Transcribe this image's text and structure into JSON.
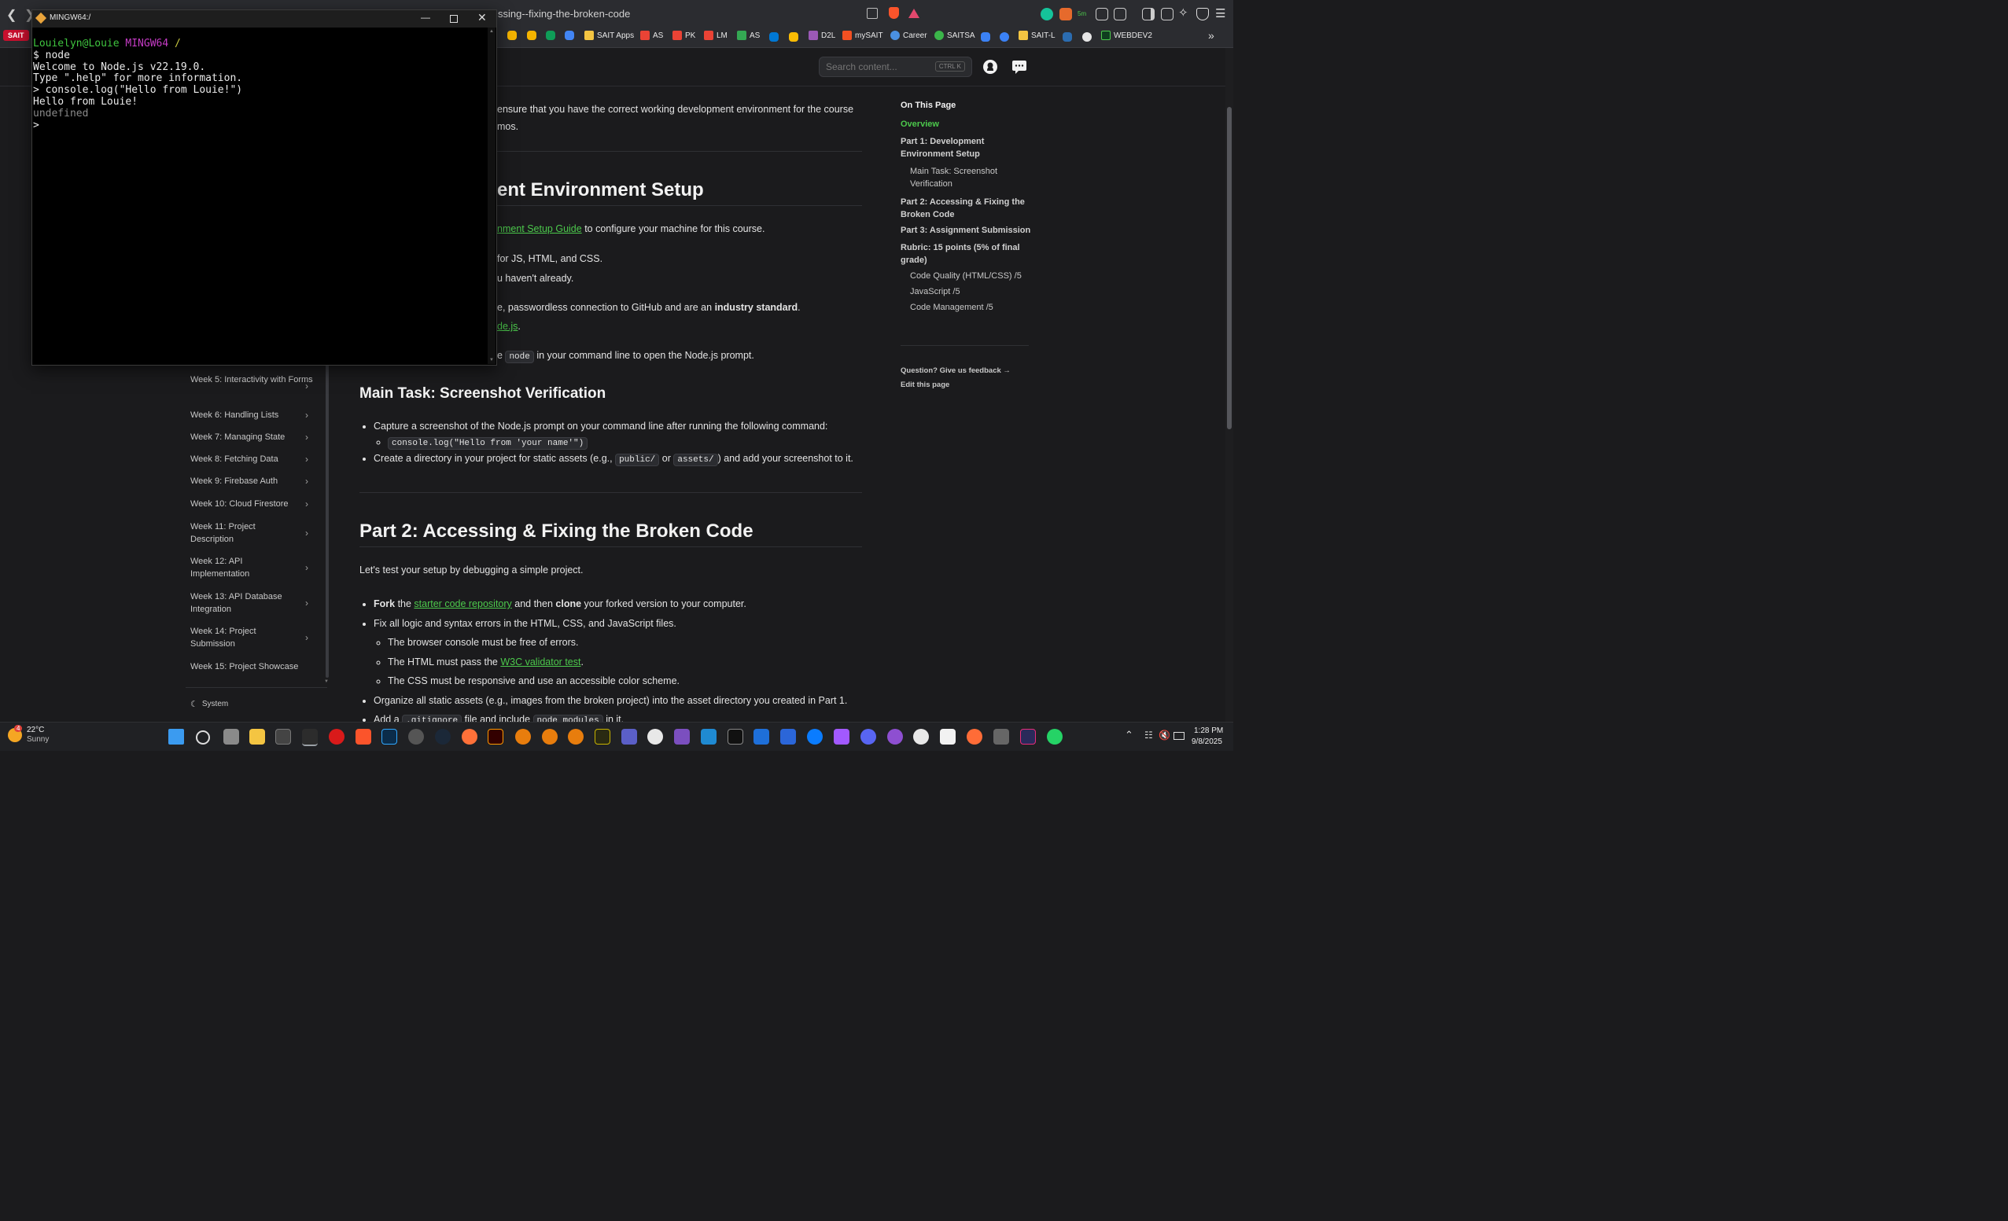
{
  "browser": {
    "url_fragment": "ssing--fixing-the-broken-code",
    "sait_badge": "SAIT",
    "bookmarks": [
      "SAIT Apps",
      "AS",
      "PK",
      "LM",
      "AS",
      "D2L",
      "mySAIT",
      "Career",
      "SAITSA",
      "SAIT-L",
      "WEBDEV2"
    ],
    "more_chevron": "»"
  },
  "terminal": {
    "title": "MINGW64:/",
    "prompt_user": "Louielyn@Louie",
    "prompt_env": "MINGW64",
    "prompt_path": "/",
    "lines": [
      "$ node",
      "Welcome to Node.js v22.19.0.",
      "Type \".help\" for more information.",
      "> console.log(\"Hello from Louie!\")",
      "Hello from Louie!"
    ],
    "undefined_line": "undefined",
    "last_prompt": ">"
  },
  "header": {
    "search_placeholder": "Search content...",
    "kbd": "CTRL K"
  },
  "content": {
    "intro_a": "ensure that you have the correct working development environment for the course",
    "intro_b": "mos.",
    "part1_heading": "ent Environment Setup",
    "setup_link": "nment Setup Guide",
    "setup_rest": " to configure your machine for this course.",
    "line_js": "for JS, HTML, and CSS.",
    "line_already": "u haven't already.",
    "line_ssh_a": "e, passwordless connection to GitHub and are an ",
    "line_ssh_bold": "industry standard",
    "line_ssh_end": ".",
    "node_link": "de.js",
    "node_end": ".",
    "line_node_a": "e ",
    "line_node_code": "node",
    "line_node_rest": " in your command line to open the Node.js prompt.",
    "main_task_heading": "Main Task: Screenshot Verification",
    "mt_bullet1": "Capture a screenshot of the Node.js prompt on your command line after running the following command:",
    "mt_code": "console.log(\"Hello from 'your name'\")",
    "mt_bullet2_a": "Create a directory in your project for static assets (e.g., ",
    "mt_code_public": "public/",
    "mt_or": " or ",
    "mt_code_assets": "assets/",
    "mt_bullet2_b": ") and add your screenshot to it.",
    "part2_heading": "Part 2: Accessing & Fixing the Broken Code",
    "p2_intro": "Let's test your setup by debugging a simple project.",
    "fork_bold": "Fork",
    "fork_the": " the ",
    "starter_link": "starter code repository",
    "fork_mid": " and then ",
    "clone_bold": "clone",
    "fork_end": " your forked version to your computer.",
    "fix_line": "Fix all logic and syntax errors in the HTML, CSS, and JavaScript files.",
    "console_line": "The browser console must be free of errors.",
    "html_line_a": "The HTML must pass the ",
    "w3c_link": "W3C validator test",
    "html_line_end": ".",
    "css_line": "The CSS must be responsive and use an accessible color scheme.",
    "organize_line": "Organize all static assets (e.g., images from the broken project) into the asset directory you created in Part 1.",
    "add_a": "Add a ",
    "add_code1": ".gitignore",
    "add_mid": " file and include ",
    "add_code2": "node_modules",
    "add_end": " in it."
  },
  "sidebar": {
    "items": [
      "Week 5: Interactivity with Forms",
      "Week 6: Handling Lists",
      "Week 7: Managing State",
      "Week 8: Fetching Data",
      "Week 9: Firebase Auth",
      "Week 10: Cloud Firestore",
      "Week 11: Project Description",
      "Week 12: API Implementation",
      "Week 13: API Database Integration",
      "Week 14: Project Submission",
      "Week 15: Project Showcase"
    ],
    "theme_label": "System"
  },
  "toc": {
    "title": "On This Page",
    "overview": "Overview",
    "part1": "Part 1: Development Environment Setup",
    "main_task": "Main Task: Screenshot Verification",
    "part2": "Part 2: Accessing & Fixing the Broken Code",
    "part3": "Part 3: Assignment Submission",
    "rubric": "Rubric: 15 points (5% of final grade)",
    "code_quality": "Code Quality (HTML/CSS) /5",
    "javascript": "JavaScript /5",
    "code_mgmt": "Code Management /5",
    "feedback": "Question? Give us feedback →",
    "edit": "Edit this page"
  },
  "taskbar": {
    "weather_temp": "22°C",
    "weather_desc": "Sunny",
    "weather_badge": "4",
    "time": "1:28 PM",
    "date": "9/8/2025"
  },
  "colors": {
    "accent_green": "#4cc94c",
    "terminal_green": "#3fc43f",
    "terminal_magenta": "#c63cc6",
    "terminal_yellow": "#c8c840"
  }
}
